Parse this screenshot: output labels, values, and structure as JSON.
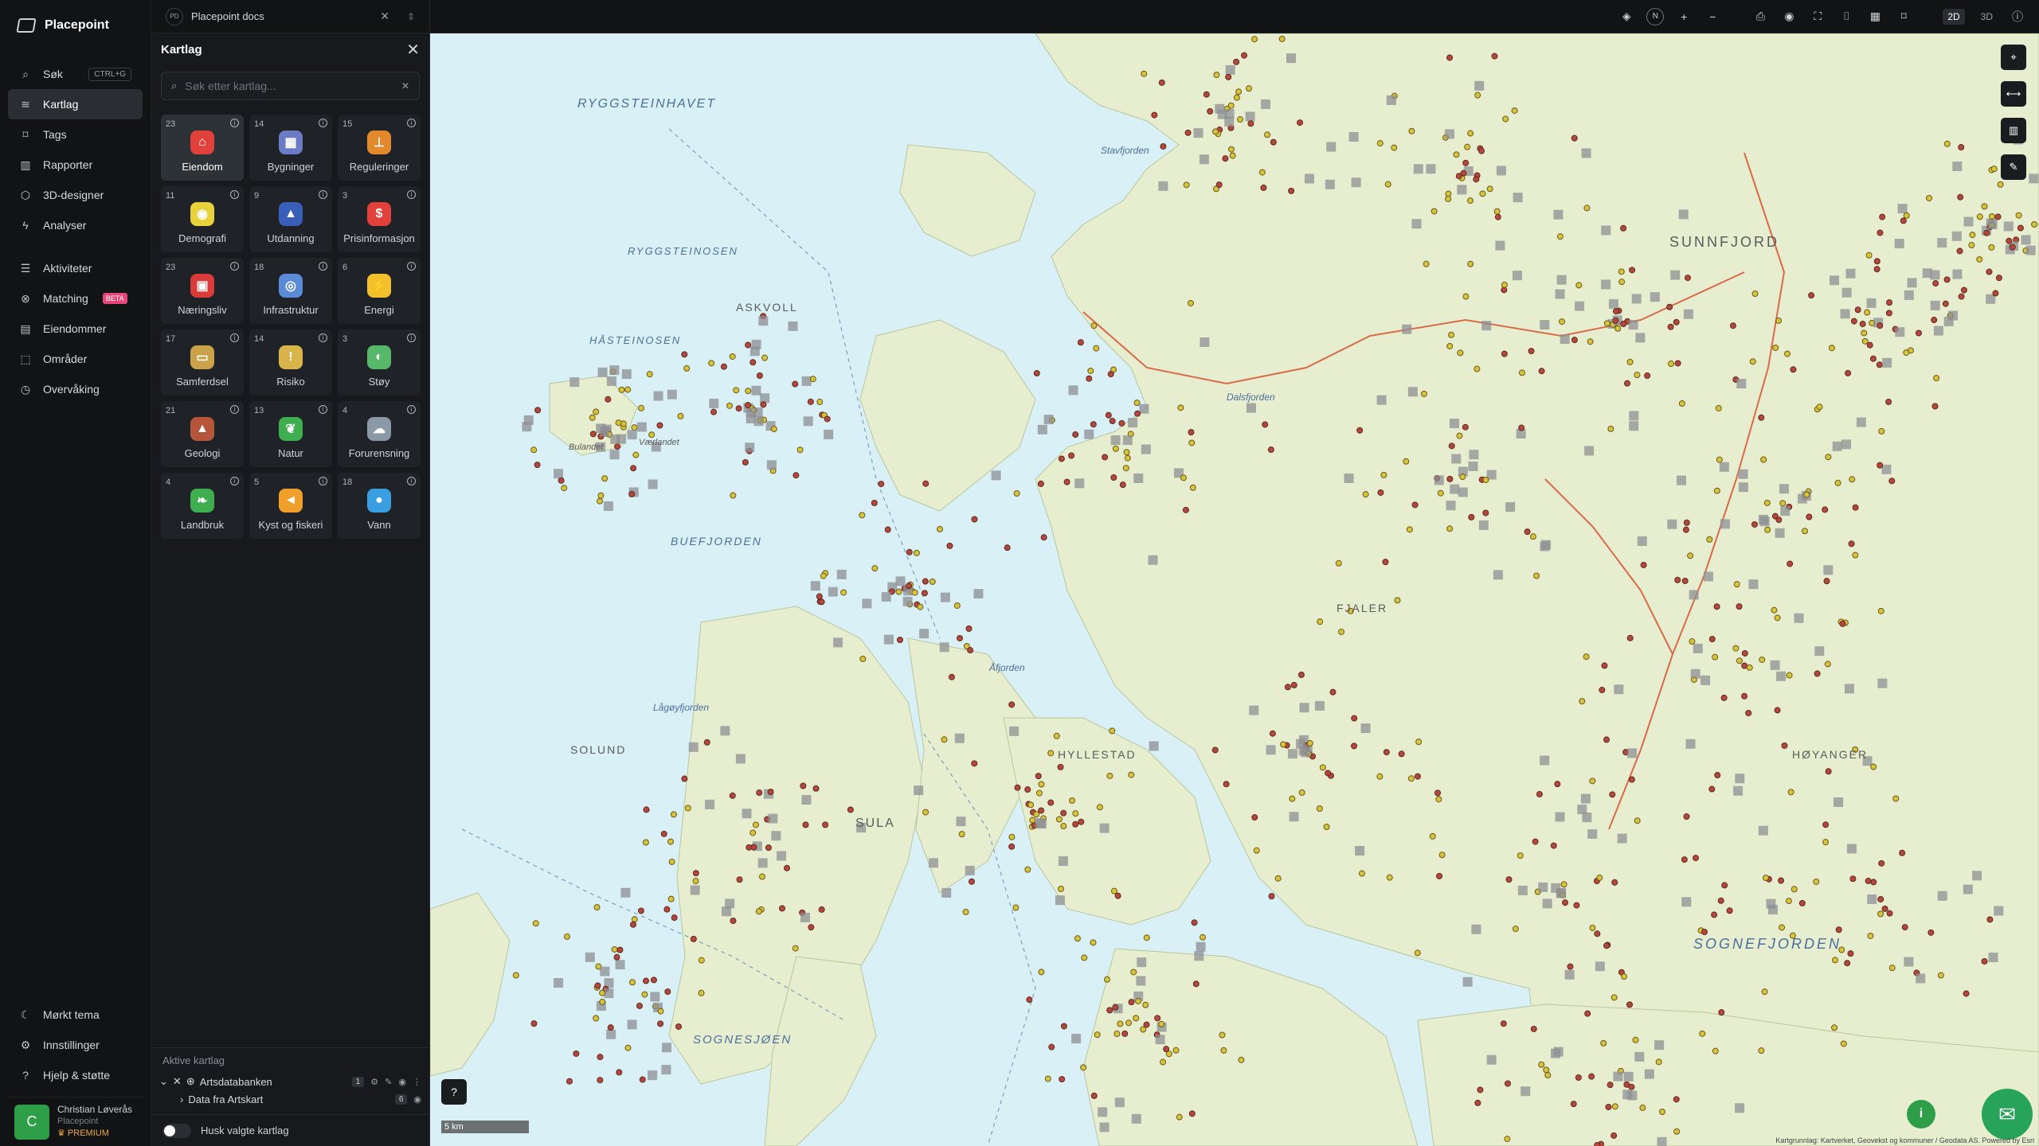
{
  "app": {
    "name": "Placepoint"
  },
  "nav": {
    "search": {
      "label": "Søk",
      "shortcut": "CTRL+G"
    },
    "items": [
      {
        "label": "Kartlag",
        "icon": "layers-icon"
      },
      {
        "label": "Tags",
        "icon": "tag-icon"
      },
      {
        "label": "Rapporter",
        "icon": "chart-icon"
      },
      {
        "label": "3D-designer",
        "icon": "cube-icon"
      },
      {
        "label": "Analyser",
        "icon": "bolt-icon"
      }
    ],
    "items2": [
      {
        "label": "Aktiviteter",
        "icon": "activity-icon"
      },
      {
        "label": "Matching",
        "icon": "matching-icon",
        "badge": "BETA"
      },
      {
        "label": "Eiendommer",
        "icon": "building-icon"
      },
      {
        "label": "Områder",
        "icon": "area-icon"
      },
      {
        "label": "Overvåking",
        "icon": "monitor-icon"
      }
    ],
    "bottom": [
      {
        "label": "Mørkt tema",
        "icon": "moon-icon"
      },
      {
        "label": "Innstillinger",
        "icon": "gear-icon"
      },
      {
        "label": "Hjelp & støtte",
        "icon": "help-icon"
      }
    ],
    "user": {
      "initial": "C",
      "name": "Christian Løverås",
      "org": "Placepoint",
      "plan": "PREMIUM"
    }
  },
  "doc_tab": {
    "badge": "PD",
    "title": "Placepoint docs"
  },
  "panel": {
    "title": "Kartlag",
    "search_placeholder": "Søk etter kartlag...",
    "categories": [
      {
        "count": "23",
        "label": "Eiendom",
        "color": "#e0413a",
        "glyph": "⌂"
      },
      {
        "count": "14",
        "label": "Bygninger",
        "color": "#6b7cc4",
        "glyph": "▦"
      },
      {
        "count": "15",
        "label": "Reguleringer",
        "color": "#e28a2b",
        "glyph": "⊥"
      },
      {
        "count": "11",
        "label": "Demografi",
        "color": "#e8d23b",
        "glyph": "◉"
      },
      {
        "count": "9",
        "label": "Utdanning",
        "color": "#3a5fb8",
        "glyph": "▲"
      },
      {
        "count": "3",
        "label": "Prisinformasjon",
        "color": "#e0413a",
        "glyph": "$"
      },
      {
        "count": "23",
        "label": "Næringsliv",
        "color": "#d93a3a",
        "glyph": "▣"
      },
      {
        "count": "18",
        "label": "Infrastruktur",
        "color": "#5b8ad6",
        "glyph": "◎"
      },
      {
        "count": "6",
        "label": "Energi",
        "color": "#f1c02a",
        "glyph": "⚡"
      },
      {
        "count": "17",
        "label": "Samferdsel",
        "color": "#c9a24a",
        "glyph": "▭"
      },
      {
        "count": "14",
        "label": "Risiko",
        "color": "#d8b44a",
        "glyph": "!"
      },
      {
        "count": "3",
        "label": "Støy",
        "color": "#58b86a",
        "glyph": "◐"
      },
      {
        "count": "21",
        "label": "Geologi",
        "color": "#b5563a",
        "glyph": "▲"
      },
      {
        "count": "13",
        "label": "Natur",
        "color": "#3fae4f",
        "glyph": "❦"
      },
      {
        "count": "4",
        "label": "Forurensning",
        "color": "#8a98a8",
        "glyph": "☁"
      },
      {
        "count": "4",
        "label": "Landbruk",
        "color": "#3fae4f",
        "glyph": "❧"
      },
      {
        "count": "5",
        "label": "Kyst og fiskeri",
        "color": "#f0a02a",
        "glyph": "◄"
      },
      {
        "count": "18",
        "label": "Vann",
        "color": "#3a9fe0",
        "glyph": "●"
      }
    ],
    "active_layers": {
      "title": "Aktive kartlag",
      "layer": {
        "name": "Artsdatabanken",
        "count": "1"
      },
      "sublayer": {
        "name": "Data fra Artskart",
        "count": "6"
      },
      "remember": "Husk valgte kartlag"
    }
  },
  "topbar": {
    "north": "N",
    "plus": "+",
    "minus": "−",
    "mode_2d": "2D",
    "mode_3d": "3D"
  },
  "map": {
    "labels": [
      {
        "text": "RYGGSTEINHAVET",
        "type": "water"
      },
      {
        "text": "RYGGSTEINOSEN",
        "type": "water"
      },
      {
        "text": "ASKVOLL",
        "type": "land"
      },
      {
        "text": "HÅSTEINOSEN",
        "type": "water"
      },
      {
        "text": "BUEFJORDEN",
        "type": "water"
      },
      {
        "text": "SUNNFJORD",
        "type": "land"
      },
      {
        "text": "Stavfjorden",
        "type": "water"
      },
      {
        "text": "Dalsfjorden",
        "type": "water"
      },
      {
        "text": "FJALER",
        "type": "land"
      },
      {
        "text": "SOLUND",
        "type": "land"
      },
      {
        "text": "SULA",
        "type": "land"
      },
      {
        "text": "HYLLESTAD",
        "type": "land"
      },
      {
        "text": "SOGNESJØEN",
        "type": "water"
      },
      {
        "text": "SOGNEFJORDEN",
        "type": "water"
      },
      {
        "text": "HØYANGER",
        "type": "land"
      },
      {
        "text": "Lågøyfjorden",
        "type": "water"
      },
      {
        "text": "Åfjorden",
        "type": "water"
      },
      {
        "text": "Bulandet",
        "type": "land"
      },
      {
        "text": "Værlandet",
        "type": "land"
      }
    ],
    "scale": "5 km",
    "attribution": "Kartgrunnlag: Kartverket, Geovekst og kommuner / Geodata AS. Powered by Esri"
  }
}
